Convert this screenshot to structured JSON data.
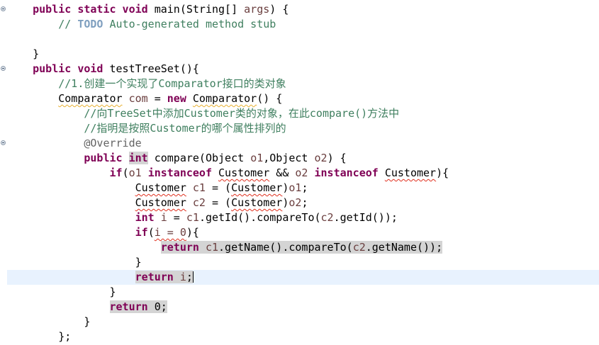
{
  "editor": {
    "lines": [
      {
        "indent": "    ",
        "segs": [
          [
            "kw",
            "public static void"
          ],
          [
            "t",
            " main(String[] "
          ],
          [
            "pv",
            "args"
          ],
          [
            "t",
            ") {"
          ]
        ]
      },
      {
        "indent": "        ",
        "segs": [
          [
            "cm",
            "// "
          ],
          [
            "todo",
            "TODO"
          ],
          [
            "cm",
            " Auto-generated method stub"
          ]
        ]
      },
      {
        "indent": "",
        "segs": []
      },
      {
        "indent": "    ",
        "segs": [
          [
            "t",
            "}"
          ]
        ]
      },
      {
        "indent": "    ",
        "segs": [
          [
            "kw",
            "public void"
          ],
          [
            "t",
            " testTreeSet(){"
          ]
        ]
      },
      {
        "indent": "        ",
        "segs": [
          [
            "cm",
            "//1.创建一个实现了Comparator接口的类对象"
          ]
        ]
      },
      {
        "indent": "        ",
        "segs": [
          [
            "wq",
            "Comparator"
          ],
          [
            "t",
            " "
          ],
          [
            "pv",
            "com"
          ],
          [
            "t",
            " = "
          ],
          [
            "kw",
            "new"
          ],
          [
            "t",
            " "
          ],
          [
            "wq",
            "Comparator"
          ],
          [
            "t",
            "() {"
          ]
        ]
      },
      {
        "indent": "            ",
        "segs": [
          [
            "cm",
            "//向TreeSet中添加Customer类的对象，在此compare()方法中"
          ]
        ]
      },
      {
        "indent": "            ",
        "segs": [
          [
            "cm",
            "//指明是按照Customer的哪个属性排列的"
          ]
        ]
      },
      {
        "indent": "            ",
        "segs": [
          [
            "ann",
            "@Override"
          ]
        ]
      },
      {
        "indent": "            ",
        "segs": [
          [
            "kw",
            "public"
          ],
          [
            "t",
            " "
          ],
          [
            "kwhl",
            "int"
          ],
          [
            "t",
            " compare(Object "
          ],
          [
            "pv",
            "o1"
          ],
          [
            "t",
            ",Object "
          ],
          [
            "pv",
            "o2"
          ],
          [
            "t",
            ") {"
          ]
        ]
      },
      {
        "indent": "                ",
        "segs": [
          [
            "kw",
            "if"
          ],
          [
            "t",
            "("
          ],
          [
            "pv",
            "o1"
          ],
          [
            "t",
            " "
          ],
          [
            "kw",
            "instanceof"
          ],
          [
            "t",
            " "
          ],
          [
            "sq",
            "Customer"
          ],
          [
            "t",
            " && "
          ],
          [
            "pv",
            "o2"
          ],
          [
            "t",
            " "
          ],
          [
            "kw",
            "instanceof"
          ],
          [
            "t",
            " "
          ],
          [
            "sq",
            "Customer"
          ],
          [
            "t",
            "){"
          ]
        ]
      },
      {
        "indent": "                    ",
        "segs": [
          [
            "sq",
            "Customer"
          ],
          [
            "t",
            " "
          ],
          [
            "pv",
            "c1"
          ],
          [
            "t",
            " = ("
          ],
          [
            "sq",
            "Customer"
          ],
          [
            "t",
            ")"
          ],
          [
            "pv",
            "o1"
          ],
          [
            "t",
            ";"
          ]
        ]
      },
      {
        "indent": "                    ",
        "segs": [
          [
            "sq",
            "Customer"
          ],
          [
            "t",
            " "
          ],
          [
            "pv",
            "c2"
          ],
          [
            "t",
            " = ("
          ],
          [
            "sq",
            "Customer"
          ],
          [
            "t",
            ")"
          ],
          [
            "pv",
            "o2"
          ],
          [
            "t",
            ";"
          ]
        ]
      },
      {
        "indent": "                    ",
        "segs": [
          [
            "kw",
            "int"
          ],
          [
            "t",
            " "
          ],
          [
            "pv",
            "i"
          ],
          [
            "t",
            " = "
          ],
          [
            "pv",
            "c1"
          ],
          [
            "t",
            ".getId().compareTo("
          ],
          [
            "pv",
            "c2"
          ],
          [
            "t",
            ".getId());"
          ]
        ]
      },
      {
        "indent": "                    ",
        "segs": [
          [
            "kw",
            "if"
          ],
          [
            "t",
            "("
          ],
          [
            "sqpv",
            "i = 0"
          ],
          [
            "t",
            "){"
          ]
        ]
      },
      {
        "indent": "                        ",
        "segs": [
          [
            "kwhl",
            "return"
          ],
          [
            "hl",
            " "
          ],
          [
            "pvhl",
            "c1"
          ],
          [
            "hl",
            ".getName().compareTo("
          ],
          [
            "pvhl",
            "c2"
          ],
          [
            "hl",
            ".getName());"
          ]
        ]
      },
      {
        "indent": "                    ",
        "segs": [
          [
            "t",
            "}"
          ]
        ]
      },
      {
        "indent": "                    ",
        "segs": [
          [
            "kwhl",
            "return"
          ],
          [
            "hl",
            " "
          ],
          [
            "pvhl",
            "i"
          ],
          [
            "hl",
            ";"
          ],
          [
            "caret",
            ""
          ]
        ],
        "current": true
      },
      {
        "indent": "                ",
        "segs": [
          [
            "t",
            "}"
          ]
        ]
      },
      {
        "indent": "                ",
        "segs": [
          [
            "kwhl",
            "return"
          ],
          [
            "hl",
            " 0;"
          ]
        ]
      },
      {
        "indent": "            ",
        "segs": [
          [
            "t",
            "}"
          ]
        ]
      },
      {
        "indent": "        ",
        "segs": [
          [
            "t",
            "};"
          ]
        ]
      }
    ],
    "fold_markers_on_lines": [
      0,
      4,
      9
    ]
  }
}
